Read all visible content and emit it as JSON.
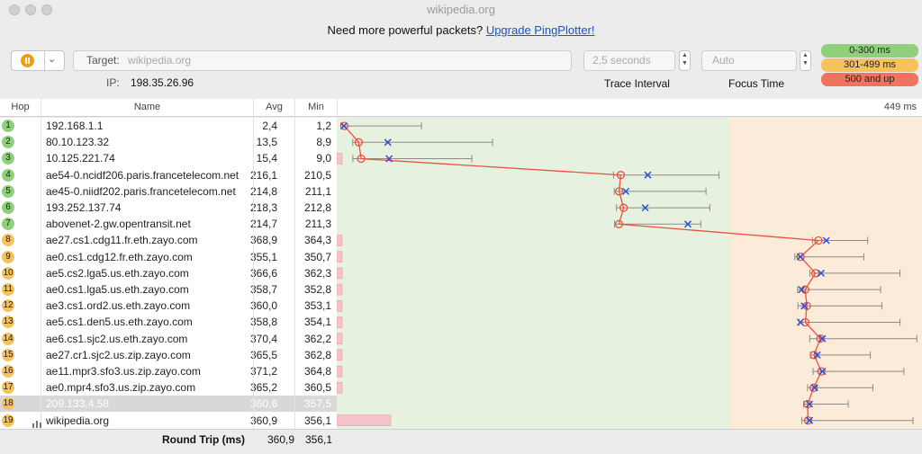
{
  "window": {
    "title": "wikipedia.org"
  },
  "promo": {
    "text": "Need more powerful packets?",
    "link": "Upgrade PingPlotter!"
  },
  "toolbar": {
    "target_label": "Target:",
    "target_value": "wikipedia.org",
    "ip_label": "IP:",
    "ip_value": "198.35.26.96",
    "interval_value": "2,5 seconds",
    "interval_label": "Trace Interval",
    "focus_value": "Auto",
    "focus_label": "Focus Time"
  },
  "legend": {
    "good": {
      "label": "0-300 ms",
      "color": "#8fd17a"
    },
    "warn": {
      "label": "301-499 ms",
      "color": "#f7c25b"
    },
    "bad": {
      "label": "500 and up",
      "color": "#f0735f"
    }
  },
  "columns": {
    "hop": "Hop",
    "name": "Name",
    "avg": "Avg",
    "min": "Min",
    "scale_max": "449 ms"
  },
  "colors": {
    "good_zone": "#e6f2df",
    "warn_zone": "#fcebd8",
    "line": "#e8533f",
    "cross": "#2f4fd6",
    "loss": "#f6c4c8"
  },
  "hops": [
    {
      "hop": "1",
      "name": "192.168.1.1",
      "avg": "2,4",
      "min": "1,2",
      "zone": "g"
    },
    {
      "hop": "2",
      "name": "80.10.123.32",
      "avg": "13,5",
      "min": "8,9",
      "zone": "g"
    },
    {
      "hop": "3",
      "name": "10.125.221.74",
      "avg": "15,4",
      "min": "9,0",
      "zone": "g"
    },
    {
      "hop": "4",
      "name": "ae54-0.ncidf206.paris.francetelecom.net",
      "avg": "216,1",
      "min": "210,5",
      "zone": "g"
    },
    {
      "hop": "5",
      "name": "ae45-0.niidf202.paris.francetelecom.net",
      "avg": "214,8",
      "min": "211,1",
      "zone": "g"
    },
    {
      "hop": "6",
      "name": "193.252.137.74",
      "avg": "218,3",
      "min": "212,8",
      "zone": "g"
    },
    {
      "hop": "7",
      "name": "abovenet-2.gw.opentransit.net",
      "avg": "214,7",
      "min": "211,3",
      "zone": "g"
    },
    {
      "hop": "8",
      "name": "ae27.cs1.cdg11.fr.eth.zayo.com",
      "avg": "368,9",
      "min": "364,3",
      "zone": "o"
    },
    {
      "hop": "9",
      "name": "ae0.cs1.cdg12.fr.eth.zayo.com",
      "avg": "355,1",
      "min": "350,7",
      "zone": "o"
    },
    {
      "hop": "10",
      "name": "ae5.cs2.lga5.us.eth.zayo.com",
      "avg": "366,6",
      "min": "362,3",
      "zone": "o"
    },
    {
      "hop": "11",
      "name": "ae0.cs1.lga5.us.eth.zayo.com",
      "avg": "358,7",
      "min": "352,8",
      "zone": "o"
    },
    {
      "hop": "12",
      "name": "ae3.cs1.ord2.us.eth.zayo.com",
      "avg": "360,0",
      "min": "353,1",
      "zone": "o"
    },
    {
      "hop": "13",
      "name": "ae5.cs1.den5.us.eth.zayo.com",
      "avg": "358,8",
      "min": "354,1",
      "zone": "o"
    },
    {
      "hop": "14",
      "name": "ae6.cs1.sjc2.us.eth.zayo.com",
      "avg": "370,4",
      "min": "362,2",
      "zone": "o"
    },
    {
      "hop": "15",
      "name": "ae27.cr1.sjc2.us.zip.zayo.com",
      "avg": "365,5",
      "min": "362,8",
      "zone": "o"
    },
    {
      "hop": "16",
      "name": "ae11.mpr3.sfo3.us.zip.zayo.com",
      "avg": "371,2",
      "min": "364,8",
      "zone": "o"
    },
    {
      "hop": "17",
      "name": "ae0.mpr4.sfo3.us.zip.zayo.com",
      "avg": "365,2",
      "min": "360,5",
      "zone": "o"
    },
    {
      "hop": "18",
      "name": "209.133.4.58",
      "avg": "360,6",
      "min": "357,5",
      "zone": "o"
    },
    {
      "hop": "19",
      "name": "wikipedia.org",
      "avg": "360,9",
      "min": "356,1",
      "zone": "o"
    }
  ],
  "footer": {
    "label": "Round Trip (ms)",
    "avg": "360,9",
    "min": "356,1"
  },
  "chart_data": {
    "type": "line",
    "xlim": [
      0,
      449
    ],
    "thresholds": [
      300,
      500
    ],
    "hops": [
      1,
      2,
      3,
      4,
      5,
      6,
      7,
      8,
      9,
      10,
      11,
      12,
      13,
      14,
      15,
      16,
      17,
      18,
      19
    ],
    "avg": [
      2.4,
      13.5,
      15.4,
      216.1,
      214.8,
      218.3,
      214.7,
      368.9,
      355.1,
      366.6,
      358.7,
      360.0,
      358.8,
      370.4,
      365.5,
      371.2,
      365.2,
      360.6,
      360.9
    ],
    "min": [
      1.2,
      8.9,
      9.0,
      210.5,
      211.1,
      212.8,
      211.3,
      364.3,
      350.7,
      362.3,
      352.8,
      353.1,
      354.1,
      362.2,
      362.8,
      364.8,
      360.5,
      357.5,
      356.1
    ],
    "cur": [
      2,
      36,
      37,
      237,
      220,
      235,
      268,
      375,
      355,
      371,
      356,
      358,
      355,
      372,
      368,
      372,
      366,
      362,
      362
    ],
    "max": [
      62,
      117,
      101,
      292,
      282,
      285,
      278,
      407,
      404,
      432,
      417,
      418,
      432,
      445,
      409,
      435,
      411,
      392,
      442
    ],
    "loss_pct": [
      0,
      0,
      2,
      0,
      0,
      0,
      0,
      2,
      2,
      2,
      2,
      2,
      2,
      2,
      2,
      2,
      2,
      0,
      20
    ]
  }
}
